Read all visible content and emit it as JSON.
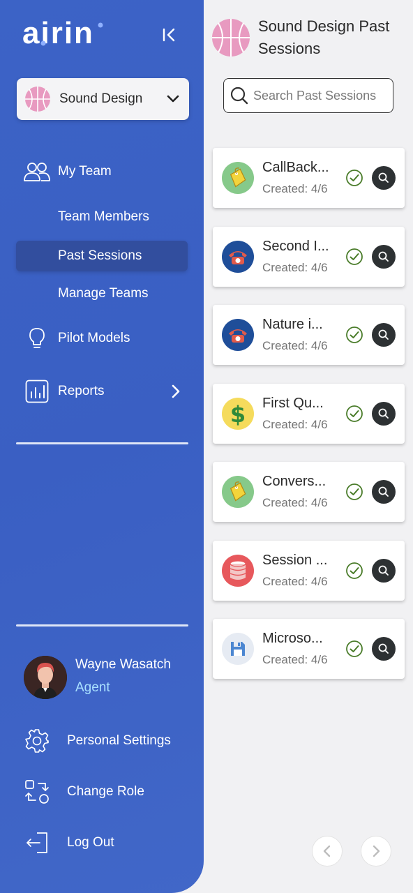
{
  "sidebar": {
    "logo_text": "airin",
    "team_selector": {
      "label": "Sound Design"
    },
    "nav": {
      "my_team": "My Team",
      "team_members": "Team Members",
      "past_sessions": "Past Sessions",
      "manage_teams": "Manage Teams",
      "pilot_models": "Pilot Models",
      "reports": "Reports"
    },
    "user": {
      "name": "Wayne Wasatch",
      "role": "Agent"
    },
    "bottom": {
      "personal_settings": "Personal Settings",
      "change_role": "Change Role",
      "log_out": "Log Out"
    }
  },
  "main": {
    "title": "Sound Design Past Sessions",
    "search": {
      "placeholder": "Search Past Sessions"
    },
    "sessions": [
      {
        "title": "CallBack...",
        "date": "Created: 4/6",
        "icon": "price-tag-icon"
      },
      {
        "title": "Second I...",
        "date": "Created: 4/6",
        "icon": "telephone-icon"
      },
      {
        "title": "Nature i...",
        "date": "Created: 4/6",
        "icon": "telephone-icon"
      },
      {
        "title": "First Qu...",
        "date": "Created: 4/6",
        "icon": "dollar-icon"
      },
      {
        "title": "Convers...",
        "date": "Created: 4/6",
        "icon": "price-tag-icon"
      },
      {
        "title": "Session ...",
        "date": "Created: 4/6",
        "icon": "database-icon"
      },
      {
        "title": "Microso...",
        "date": "Created: 4/6",
        "icon": "floppy-disk-icon"
      }
    ]
  },
  "colors": {
    "sidebar_blue": "#3c63c6",
    "active_item": "#30488f",
    "role_text": "#a9e0ff",
    "check_green": "#4a7c2a",
    "view_button": "#2d3133"
  }
}
